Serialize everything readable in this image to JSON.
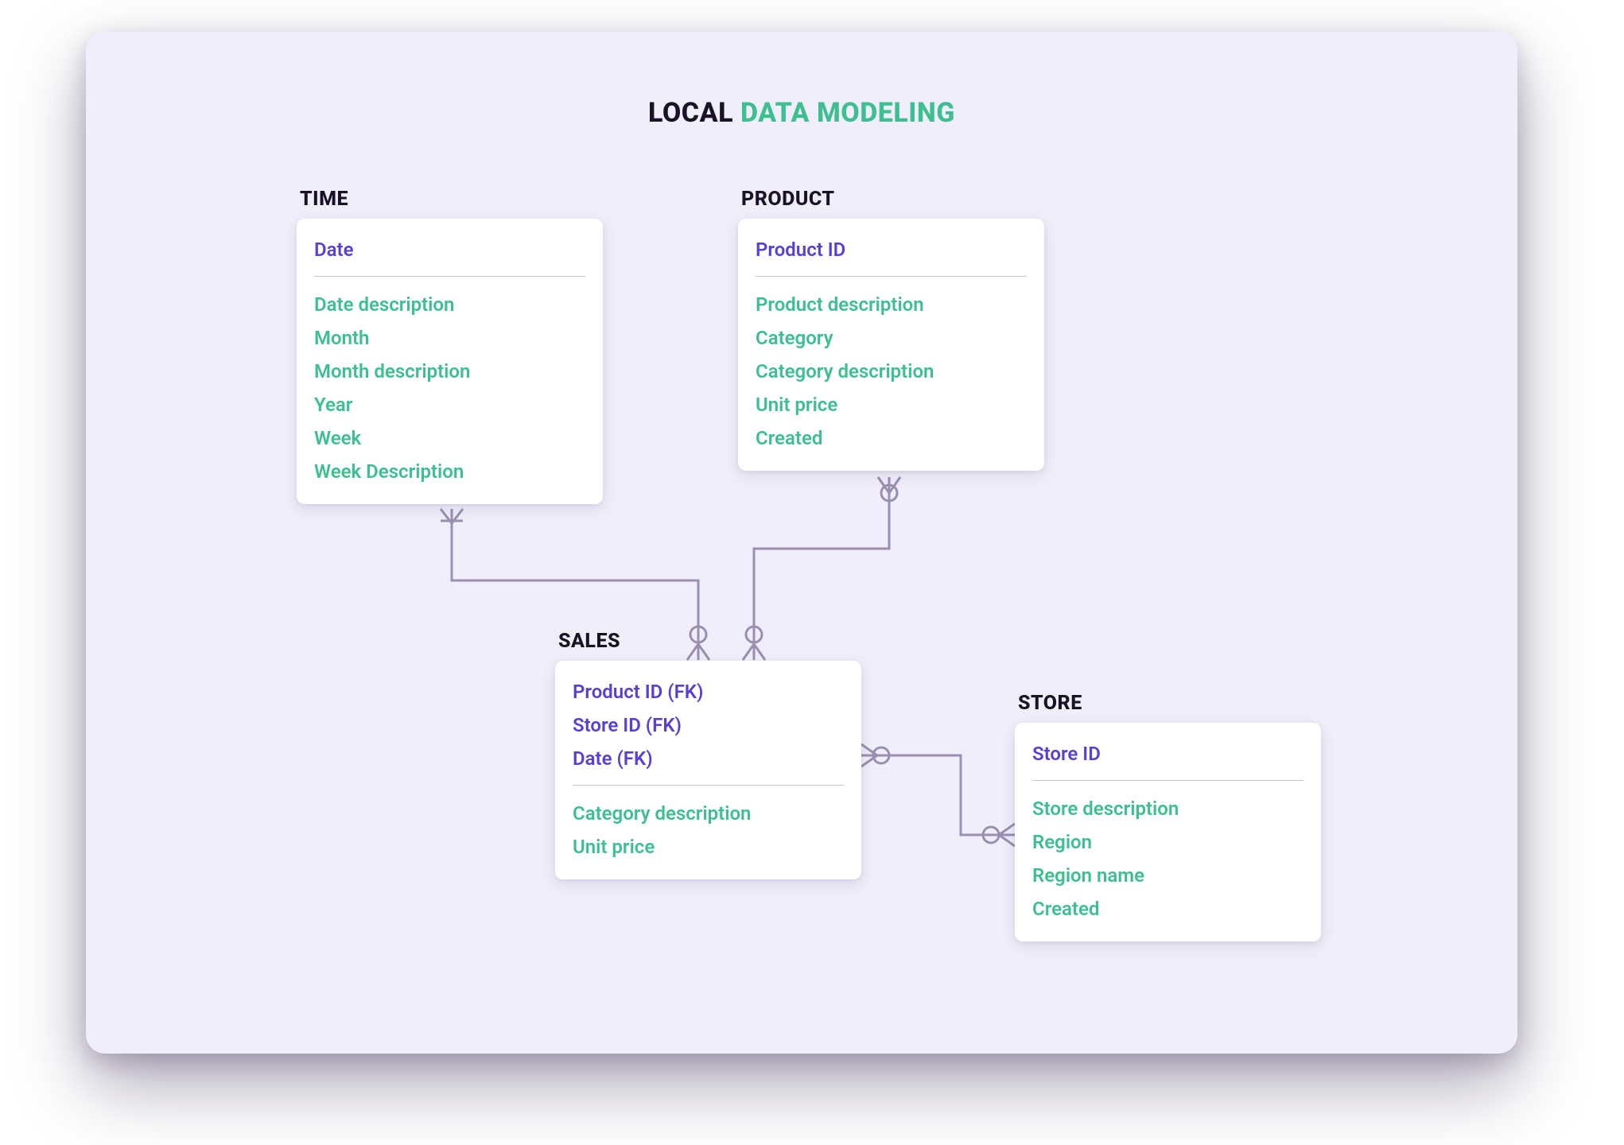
{
  "title": {
    "part1": "LOCAL ",
    "part2": "DATA MODELING"
  },
  "colors": {
    "bg": "#f0eefa",
    "key": "#5a3fd4",
    "attr": "#3dbf8f",
    "text": "#1a1226",
    "connector": "#9a8fb0"
  },
  "entities": {
    "time": {
      "label": "TIME",
      "keys": [
        "Date"
      ],
      "attrs": [
        "Date description",
        "Month",
        "Month description",
        "Year",
        "Week",
        "Week Description"
      ]
    },
    "product": {
      "label": "PRODUCT",
      "keys": [
        "Product ID"
      ],
      "attrs": [
        "Product description",
        "Category",
        "Category description",
        "Unit price",
        "Created"
      ]
    },
    "sales": {
      "label": "SALES",
      "keys": [
        "Product ID (FK)",
        "Store ID (FK)",
        "Date (FK)"
      ],
      "attrs": [
        "Category description",
        "Unit price"
      ]
    },
    "store": {
      "label": "STORE",
      "keys": [
        "Store ID"
      ],
      "attrs": [
        "Store description",
        "Region",
        "Region name",
        "Created"
      ]
    }
  },
  "relationships": [
    {
      "from": "time",
      "to": "sales",
      "type": "one-to-many"
    },
    {
      "from": "product",
      "to": "sales",
      "type": "one-to-many"
    },
    {
      "from": "sales",
      "to": "store",
      "type": "many-to-one"
    }
  ]
}
